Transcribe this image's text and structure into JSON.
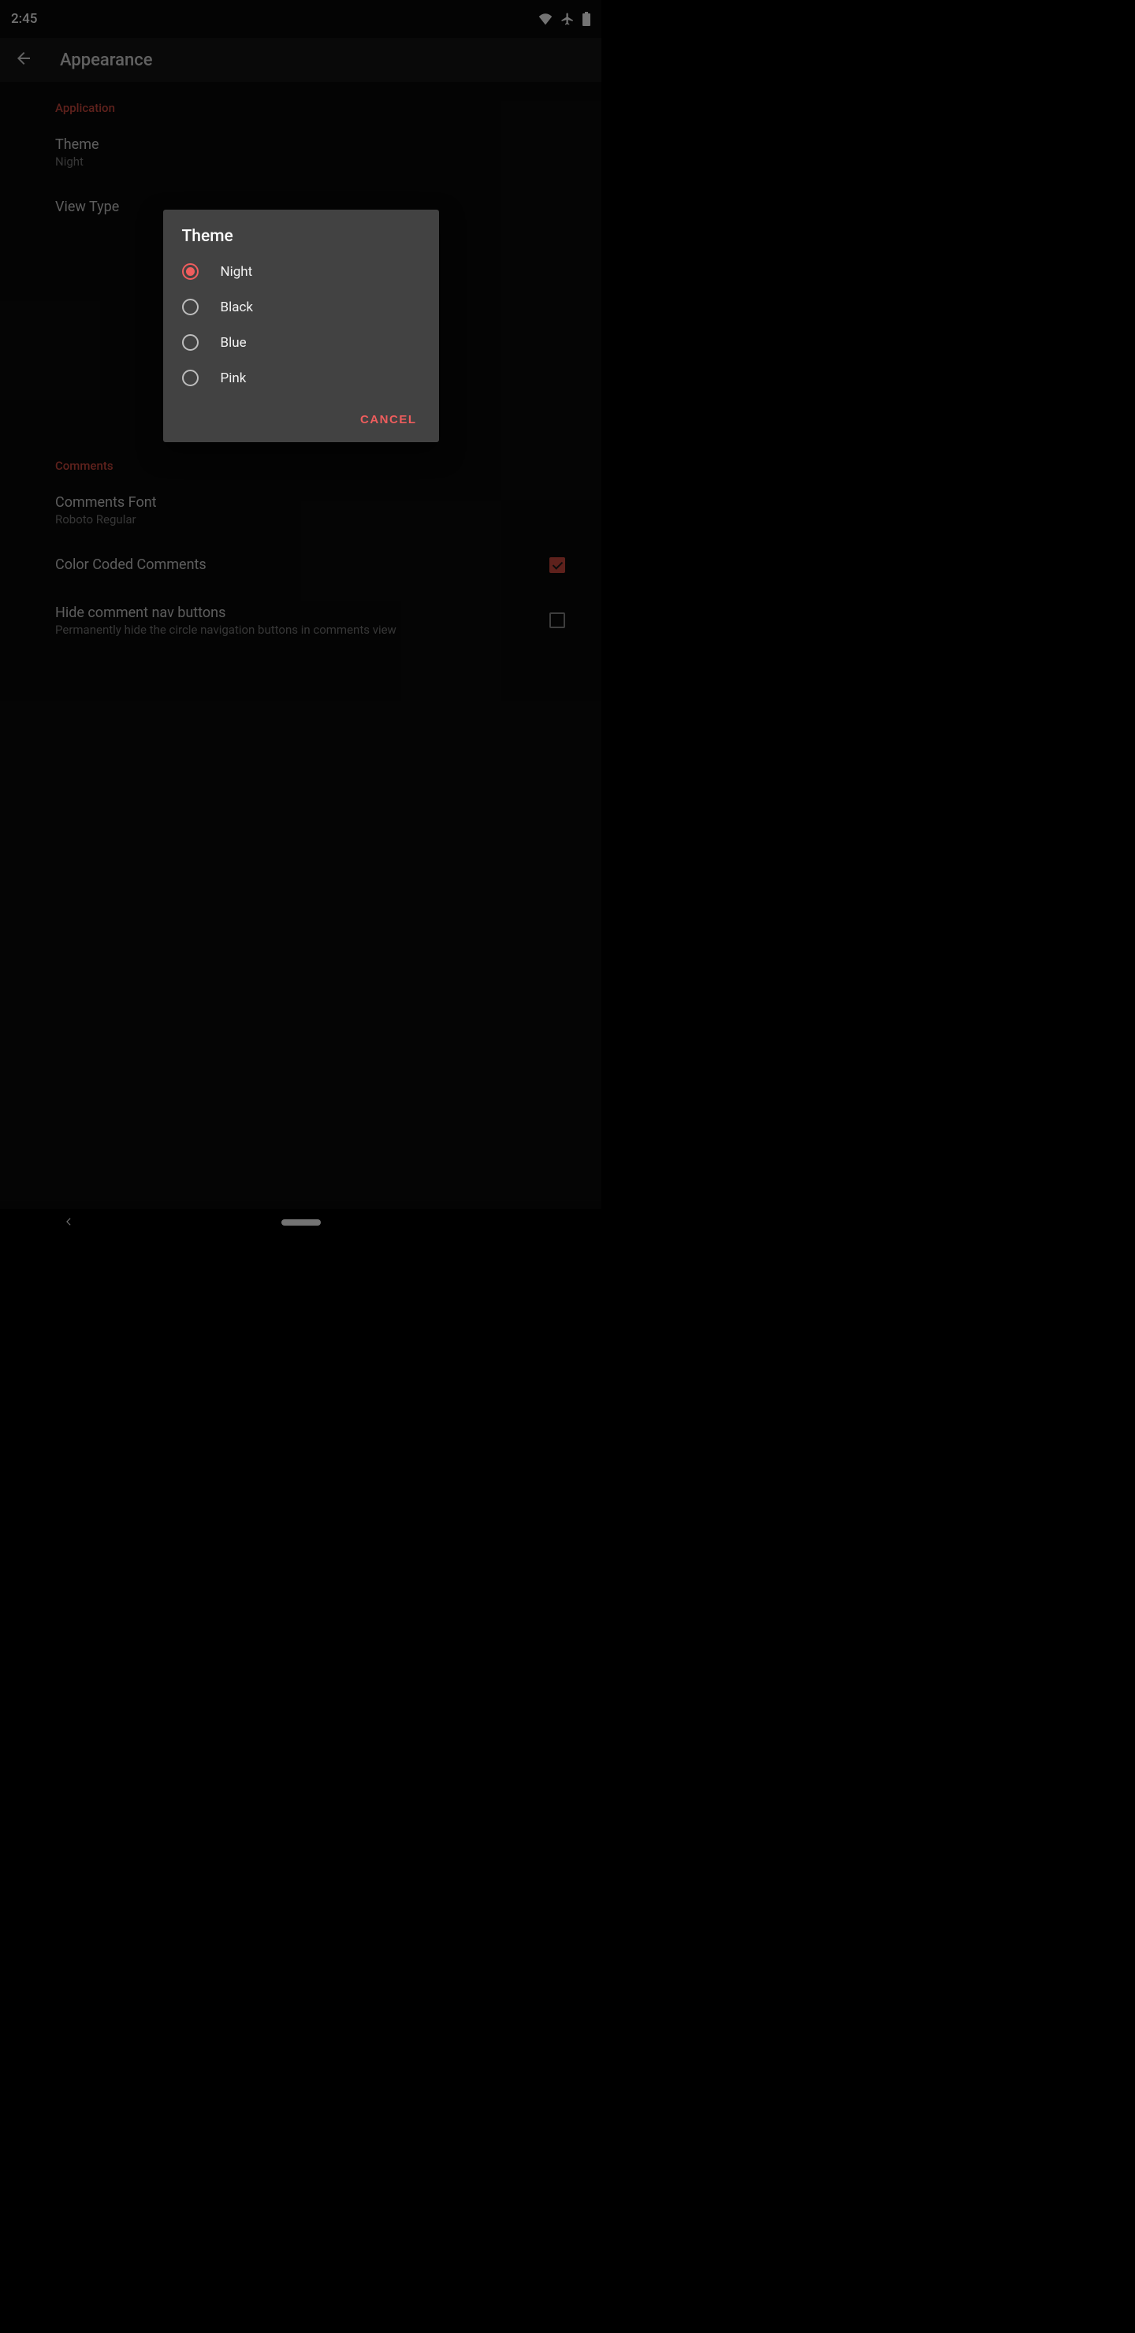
{
  "status_bar": {
    "time": "2:45",
    "icons": [
      "wifi",
      "airplane",
      "battery"
    ]
  },
  "app_bar": {
    "back_icon": "arrow-back",
    "title": "Appearance"
  },
  "sections": {
    "application": {
      "header": "Application",
      "theme": {
        "title": "Theme",
        "value": "Night"
      },
      "view_type": {
        "title": "View Type"
      }
    },
    "comments": {
      "header": "Comments",
      "font": {
        "title": "Comments Font",
        "value": "Roboto Regular"
      },
      "color_coded": {
        "title": "Color Coded Comments",
        "checked": true
      },
      "hide_nav": {
        "title": "Hide comment nav buttons",
        "sub": "Permanently hide the circle navigation buttons in comments view",
        "checked": false
      }
    }
  },
  "dialog": {
    "title": "Theme",
    "options": [
      {
        "label": "Night",
        "selected": true
      },
      {
        "label": "Black",
        "selected": false
      },
      {
        "label": "Blue",
        "selected": false
      },
      {
        "label": "Pink",
        "selected": false
      }
    ],
    "cancel_label": "Cancel"
  }
}
